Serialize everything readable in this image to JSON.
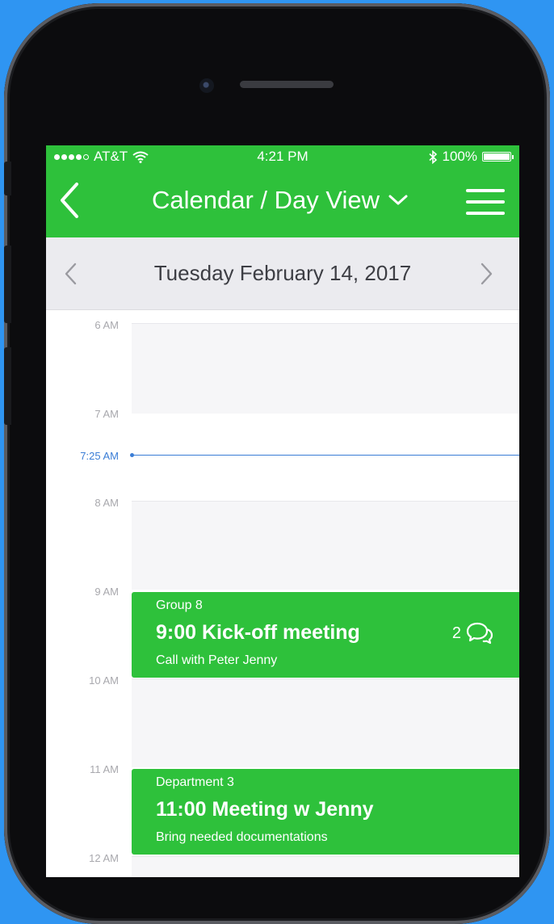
{
  "status_bar": {
    "carrier": "AT&T",
    "time": "4:21 PM",
    "battery": "100%",
    "battery_level": 1.0,
    "signal_bars_filled": 4,
    "signal_bars_total": 5
  },
  "nav": {
    "title": "Calendar / Day View",
    "back_icon": "chevron-left-icon",
    "dropdown_icon": "chevron-down-icon",
    "menu_icon": "hamburger-menu-icon"
  },
  "date_bar": {
    "date": "Tuesday February 14,  2017",
    "prev_icon": "chevron-left-icon",
    "next_icon": "chevron-right-icon"
  },
  "timeline": {
    "hours": [
      "6 AM",
      "7 AM",
      "8 AM",
      "9 AM",
      "10 AM",
      "11 AM",
      "12 AM"
    ],
    "current_time": "7:25 AM"
  },
  "events": [
    {
      "group": "Group 8",
      "title": "9:00 Kick-off meeting",
      "subtitle": "Call with Peter Jenny",
      "comment_count": "2",
      "comment_icon": "chat-bubbles-icon"
    },
    {
      "group": "Department 3",
      "title": "11:00 Meeting w Jenny",
      "subtitle": "Bring needed documentations"
    }
  ],
  "colors": {
    "background": "#2f95f2",
    "brand_green": "#2ec13b",
    "now_indicator": "#3a7dd6"
  }
}
